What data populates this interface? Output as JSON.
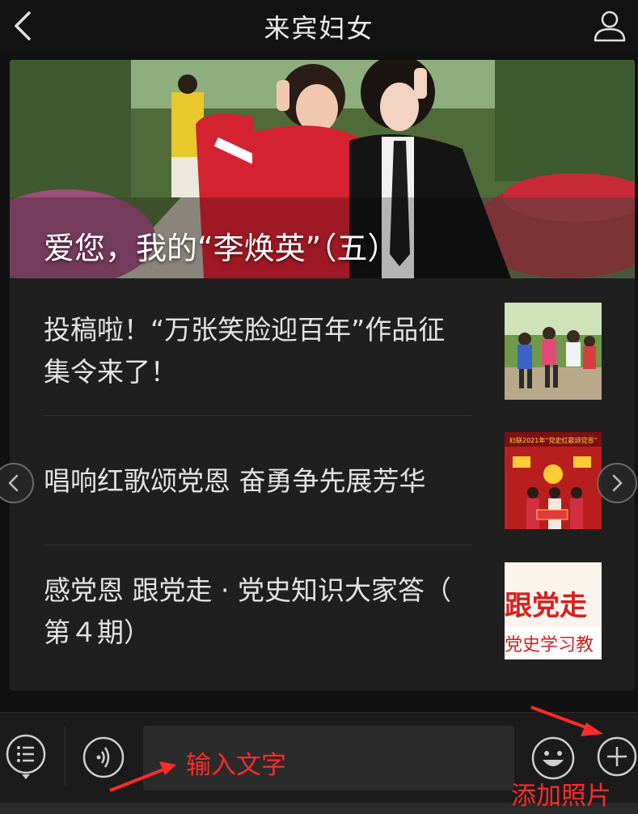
{
  "header": {
    "title": "来宾妇女"
  },
  "feed": {
    "hero_title": "爱您，我的“李焕英”（五）",
    "articles": [
      {
        "title_line1": "投稿啦！“万张笑脸迎百年”作品征",
        "title_line2": "集令来了！"
      },
      {
        "title_line1": "唱响红歌颂党恩 奋勇争先展芳华",
        "title_line2": ""
      },
      {
        "title_line1": "感党恩 跟党走 · 党史知识大家答（",
        "title_line2": "第４期）"
      }
    ],
    "thumb3_text_top": "跟党走",
    "thumb3_text_bottom": "党史学习教"
  },
  "annotations": {
    "input_label": "输入文字",
    "add_photo_label": "添加照片",
    "color": "#ff2a2a"
  },
  "icons": [
    "back-arrow-icon",
    "user-profile-icon",
    "chevron-left-icon",
    "chevron-right-icon",
    "menu-list-icon",
    "voice-icon",
    "emoji-icon",
    "plus-icon"
  ]
}
